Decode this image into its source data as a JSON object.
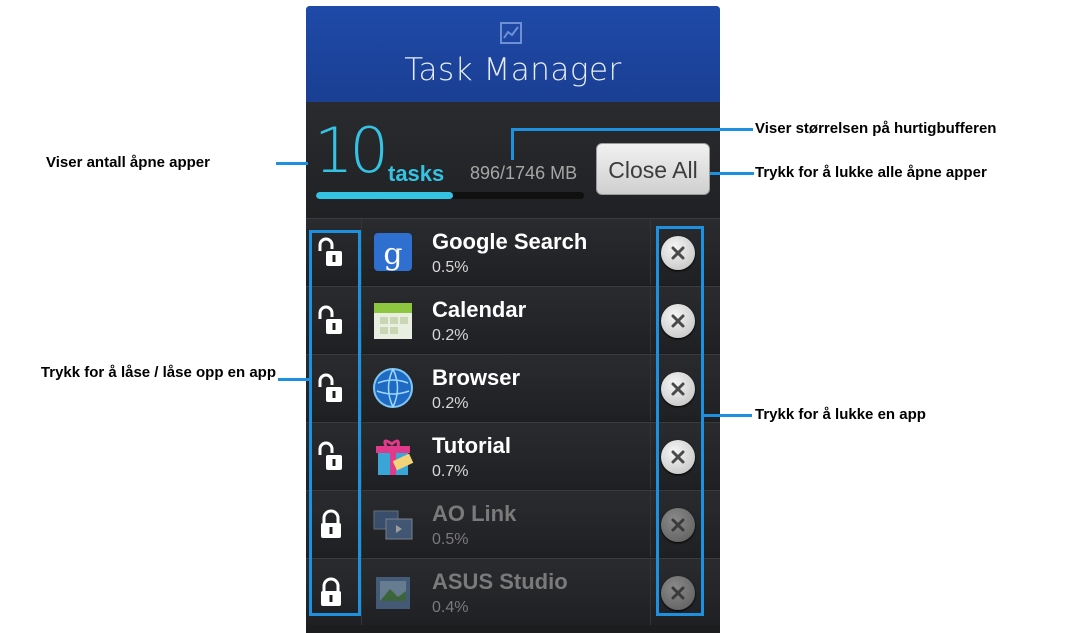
{
  "app": {
    "title": "Task Manager"
  },
  "summary": {
    "count": "10",
    "count_word": "tasks",
    "memory": "896/1746 MB",
    "memory_fraction": 0.513,
    "close_all_label": "Close All"
  },
  "apps": [
    {
      "name": "Google Search",
      "percent": "0.5%",
      "icon": "google-search-icon",
      "locked": false,
      "dim": false
    },
    {
      "name": "Calendar",
      "percent": "0.2%",
      "icon": "calendar-icon",
      "locked": false,
      "dim": false
    },
    {
      "name": "Browser",
      "percent": "0.2%",
      "icon": "browser-globe-icon",
      "locked": false,
      "dim": false
    },
    {
      "name": "Tutorial",
      "percent": "0.7%",
      "icon": "tutorial-gift-icon",
      "locked": false,
      "dim": false
    },
    {
      "name": "AO Link",
      "percent": "0.5%",
      "icon": "ao-link-icon",
      "locked": true,
      "dim": true
    },
    {
      "name": "ASUS Studio",
      "percent": "0.4%",
      "icon": "asus-studio-icon",
      "locked": true,
      "dim": true
    }
  ],
  "callouts": {
    "open_apps": "Viser antall åpne apper",
    "cache_size": "Viser størrelsen på hurtigbufferen",
    "close_all": "Trykk for å lukke alle åpne apper",
    "lock_unlock": "Trykk for å låse / låse opp en app",
    "close_app": "Trykk for å lukke en app"
  },
  "colors": {
    "accent": "#35c3e3",
    "header": "#1f4aa8",
    "callout": "#1e90e0"
  }
}
